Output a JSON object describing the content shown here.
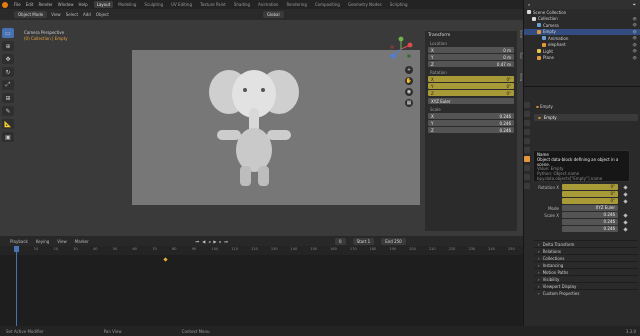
{
  "topbar": {
    "menus": [
      "File",
      "Edit",
      "Render",
      "Window",
      "Help"
    ],
    "tabs": [
      "Layout",
      "Modeling",
      "Sculpting",
      "UV Editing",
      "Texture Paint",
      "Shading",
      "Animation",
      "Rendering",
      "Compositing",
      "Geometry Nodes",
      "Scripting"
    ],
    "active_tab": "Layout",
    "scene": "Scene",
    "view_layer": "ViewLayer"
  },
  "viewport": {
    "mode": "Object Mode",
    "menus": [
      "View",
      "Select",
      "Add",
      "Object"
    ],
    "orientation": "Global",
    "camera_label": "Camera Perspective",
    "collection_label": "(0) Collection | Empty"
  },
  "npanel": {
    "header": "Transform",
    "location_label": "Location",
    "location": [
      {
        "axis": "X",
        "value": "0 m"
      },
      {
        "axis": "Y",
        "value": "0 m"
      },
      {
        "axis": "Z",
        "value": "0.47 m"
      }
    ],
    "rotation_label": "Rotation",
    "rotation": [
      {
        "axis": "X",
        "value": "0°"
      },
      {
        "axis": "Y",
        "value": "0°"
      },
      {
        "axis": "Z",
        "value": "0°"
      }
    ],
    "rotation_mode": "XYZ Euler",
    "scale_label": "Scale",
    "scale": [
      {
        "axis": "X",
        "value": "0.246"
      },
      {
        "axis": "Y",
        "value": "0.246"
      },
      {
        "axis": "Z",
        "value": "0.246"
      }
    ],
    "side_tabs": [
      "Item",
      "Tool",
      "View"
    ]
  },
  "timeline": {
    "menus": [
      "Playback",
      "Keying",
      "View",
      "Marker"
    ],
    "current_frame": "0",
    "start_label": "Start",
    "start": "1",
    "end_label": "End",
    "end": "250",
    "ticks": [
      "0",
      "10",
      "20",
      "30",
      "40",
      "50",
      "60",
      "70",
      "80",
      "90",
      "100",
      "110",
      "120",
      "130",
      "140",
      "150",
      "160",
      "170",
      "180",
      "190",
      "200",
      "210",
      "220",
      "230",
      "240",
      "250"
    ],
    "playhead": "0"
  },
  "statusbar": {
    "items": [
      "Set Active Modifier",
      "Pan View",
      "Context Menu"
    ],
    "version": "3.3.0"
  },
  "outliner": {
    "title": "Scene Collection",
    "rows": [
      {
        "label": "Scene Collection",
        "indent": 0,
        "color": "#dcdcdc",
        "selected": false
      },
      {
        "label": "Collection",
        "indent": 1,
        "color": "#dcdcdc",
        "selected": false
      },
      {
        "label": "Camera",
        "indent": 2,
        "color": "#6a9fd4",
        "selected": false
      },
      {
        "label": "Empty",
        "indent": 2,
        "color": "#e6973a",
        "selected": true
      },
      {
        "label": "Animation",
        "indent": 3,
        "color": "#6a9fd4",
        "selected": false
      },
      {
        "label": "elephant",
        "indent": 3,
        "color": "#e6973a",
        "selected": false
      },
      {
        "label": "Light",
        "indent": 2,
        "color": "#e8c64a",
        "selected": false
      },
      {
        "label": "Plane",
        "indent": 2,
        "color": "#e6973a",
        "selected": false
      }
    ]
  },
  "properties": {
    "object_path": "Empty",
    "object_name": "Empty",
    "tooltip": {
      "title": "Name",
      "desc": "Object data-block defining an object in a scene.",
      "value": "Value: Empty",
      "python1": "Python: Object.name",
      "python2": "bpy.data.objects[\"Empty\"].name"
    },
    "rotation_label": "Rotation X",
    "rotation": [
      "0°",
      "0°",
      "0°"
    ],
    "mode_label": "Mode",
    "mode": "XYZ Euler",
    "scale_label": "Scale X",
    "scale": [
      "0.246",
      "0.246",
      "0.246"
    ],
    "sections": [
      "Delta Transform",
      "Relations",
      "Collections",
      "Instancing",
      "Motion Paths",
      "Visibility",
      "Viewport Display",
      "Custom Properties"
    ]
  },
  "colors": {
    "accent": "#4772b3",
    "keyframed": "#a89a37",
    "active_object": "#e6973a"
  }
}
